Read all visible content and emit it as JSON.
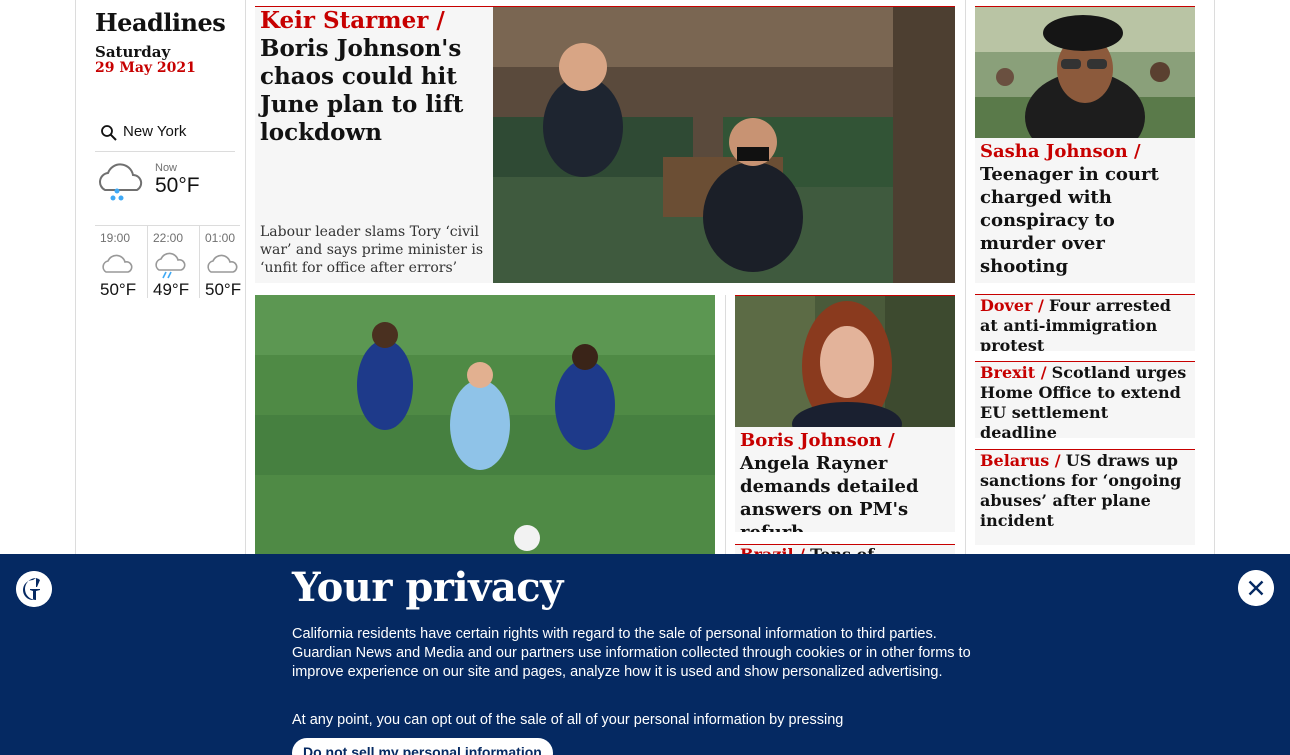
{
  "sidebar": {
    "title": "Headlines",
    "day": "Saturday",
    "date": "29 May 2021"
  },
  "weather": {
    "location": "New York",
    "now_label": "Now",
    "now_temp": "50°F",
    "now_icon": "rain-cloud-icon",
    "forecast": [
      {
        "time": "19:00",
        "temp": "50°F",
        "icon": "cloud-icon"
      },
      {
        "time": "22:00",
        "temp": "49°F",
        "icon": "rain-cloud-icon"
      },
      {
        "time": "01:00",
        "temp": "50°F",
        "icon": "cloud-icon"
      }
    ]
  },
  "stories": {
    "main": {
      "kicker": "Keir Starmer /",
      "headline": "Boris Johnson's chaos could hit June plan to lift lockdown",
      "standfirst": "Labour leader slams Tory ‘civil war’ and says prime minister is ‘unfit for office after errors’"
    },
    "sasha": {
      "kicker": "Sasha Johnson /",
      "headline": "Teenager in court charged with conspiracy to murder over shooting"
    },
    "rayner": {
      "kicker": "Boris Johnson  /",
      "headline": "Angela Rayner demands detailed answers on PM's refurb"
    },
    "brazil": {
      "kicker": "Brazil /",
      "headline": "Tens of thousands"
    },
    "dover": {
      "kicker": "Dover /",
      "headline": "Four arrested at anti-immigration protest"
    },
    "brexit": {
      "kicker": "Brexit /",
      "headline": "Scotland urges Home Office to extend EU settlement deadline"
    },
    "belarus": {
      "kicker": "Belarus /",
      "headline": "US draws up sanctions for ‘ongoing abuses’ after plane incident"
    }
  },
  "privacy": {
    "title": "Your privacy",
    "body": "California residents have certain rights with regard to the sale of personal information to third parties. Guardian News and Media and our partners use information collected through cookies or in other forms to improve experience on our site and pages, analyze how it is used and show personalized advertising.",
    "body2": "At any point, you can opt out of the sale of all of your personal information by pressing",
    "button": "Do not sell my personal information"
  },
  "colors": {
    "accent": "#c70000",
    "brand_blue": "#052962",
    "card_bg": "#f6f6f6"
  }
}
